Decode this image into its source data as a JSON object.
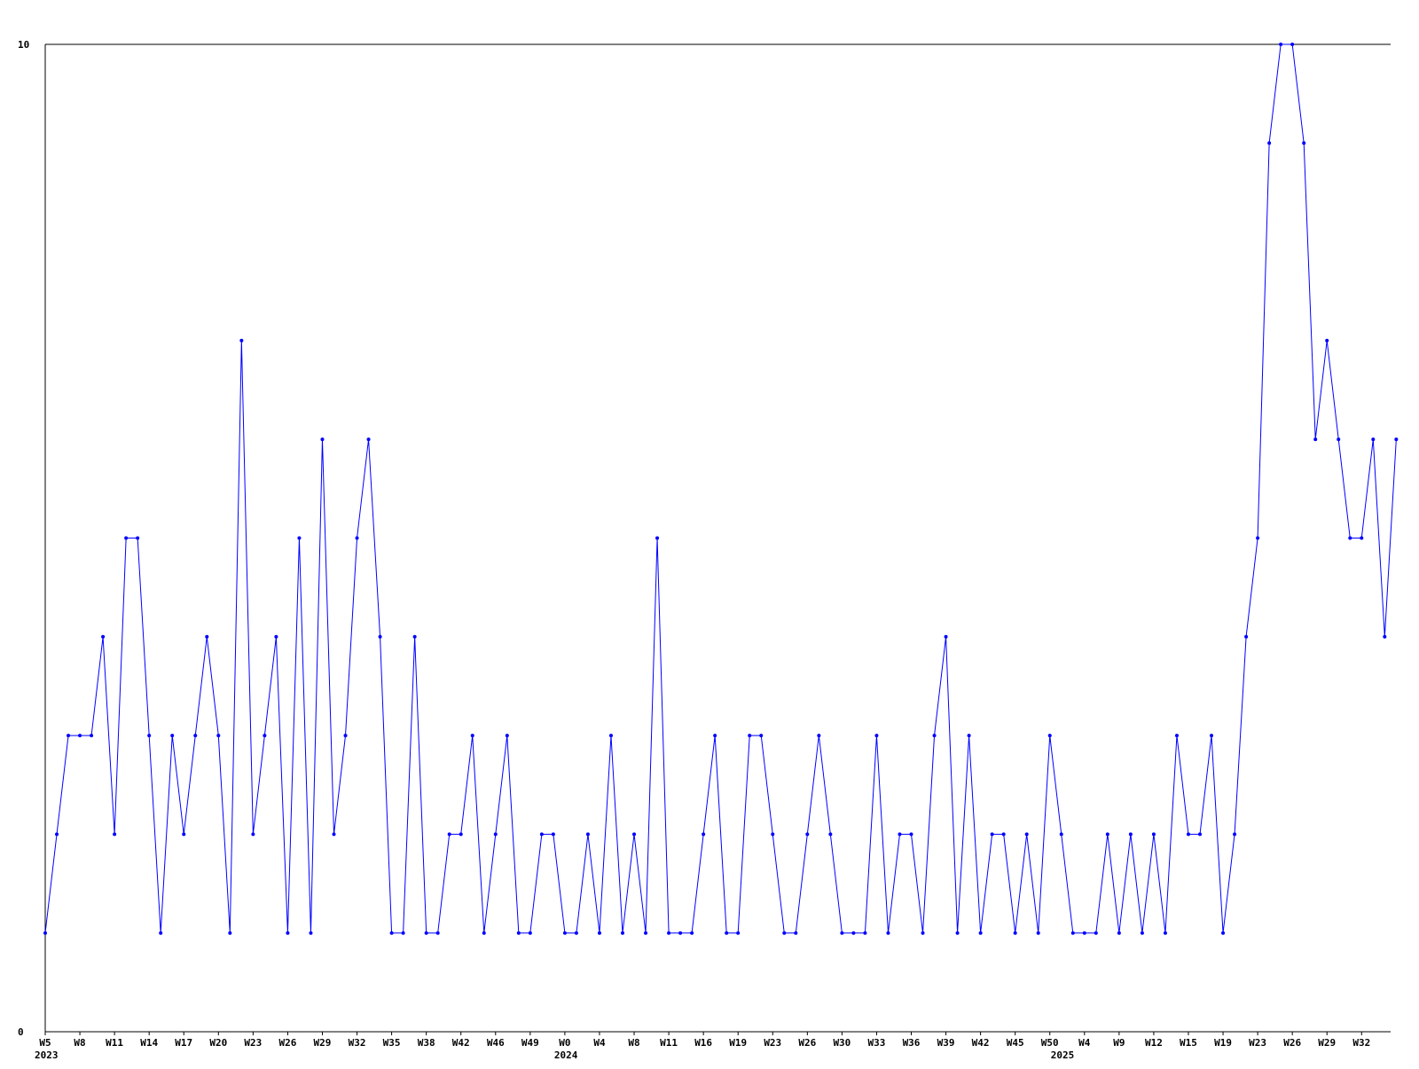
{
  "chart_data": {
    "type": "line",
    "title": "",
    "xlabel": "",
    "ylabel": "",
    "ylim": [
      0,
      10
    ],
    "y_ticks": [
      "0",
      "10"
    ],
    "grid": false,
    "legend": "none",
    "line_color": "#0000ff",
    "axis_color": "#000000",
    "x_tick_labels": [
      {
        "i": 0,
        "label": "W5"
      },
      {
        "i": 3,
        "label": "W8"
      },
      {
        "i": 6,
        "label": "W11"
      },
      {
        "i": 9,
        "label": "W14"
      },
      {
        "i": 12,
        "label": "W17"
      },
      {
        "i": 15,
        "label": "W20"
      },
      {
        "i": 18,
        "label": "W23"
      },
      {
        "i": 21,
        "label": "W26"
      },
      {
        "i": 24,
        "label": "W29"
      },
      {
        "i": 27,
        "label": "W32"
      },
      {
        "i": 30,
        "label": "W35"
      },
      {
        "i": 33,
        "label": "W38"
      },
      {
        "i": 36,
        "label": "W42"
      },
      {
        "i": 39,
        "label": "W46"
      },
      {
        "i": 42,
        "label": "W49"
      },
      {
        "i": 45,
        "label": "W0"
      },
      {
        "i": 48,
        "label": "W4"
      },
      {
        "i": 51,
        "label": "W8"
      },
      {
        "i": 54,
        "label": "W11"
      },
      {
        "i": 57,
        "label": "W16"
      },
      {
        "i": 60,
        "label": "W19"
      },
      {
        "i": 63,
        "label": "W23"
      },
      {
        "i": 66,
        "label": "W26"
      },
      {
        "i": 69,
        "label": "W30"
      },
      {
        "i": 72,
        "label": "W33"
      },
      {
        "i": 75,
        "label": "W36"
      },
      {
        "i": 78,
        "label": "W39"
      },
      {
        "i": 81,
        "label": "W42"
      },
      {
        "i": 84,
        "label": "W45"
      },
      {
        "i": 87,
        "label": "W50"
      },
      {
        "i": 90,
        "label": "W4"
      },
      {
        "i": 93,
        "label": "W9"
      },
      {
        "i": 96,
        "label": "W12"
      },
      {
        "i": 99,
        "label": "W15"
      },
      {
        "i": 102,
        "label": "W19"
      },
      {
        "i": 105,
        "label": "W23"
      },
      {
        "i": 108,
        "label": "W26"
      },
      {
        "i": 111,
        "label": "W29"
      },
      {
        "i": 114,
        "label": "W32"
      }
    ],
    "year_labels": [
      {
        "i": 0,
        "label": "2023"
      },
      {
        "i": 45,
        "label": "2024"
      },
      {
        "i": 88,
        "label": "2025"
      }
    ],
    "values": [
      1,
      2,
      3,
      3,
      3,
      4,
      2,
      5,
      5,
      3,
      1,
      3,
      2,
      3,
      4,
      3,
      1,
      7,
      2,
      3,
      4,
      1,
      5,
      1,
      6,
      2,
      3,
      5,
      6,
      4,
      1,
      1,
      4,
      1,
      1,
      2,
      2,
      3,
      1,
      2,
      3,
      1,
      1,
      2,
      2,
      1,
      1,
      2,
      1,
      3,
      1,
      2,
      1,
      5,
      1,
      1,
      1,
      2,
      3,
      1,
      1,
      3,
      3,
      2,
      1,
      1,
      2,
      3,
      2,
      1,
      1,
      1,
      3,
      1,
      2,
      2,
      1,
      3,
      4,
      1,
      3,
      1,
      2,
      2,
      1,
      2,
      1,
      3,
      2,
      1,
      1,
      1,
      2,
      1,
      2,
      1,
      2,
      1,
      3,
      2,
      2,
      3,
      1,
      2,
      4,
      5,
      9,
      10,
      10,
      9,
      6,
      7,
      6,
      5,
      5,
      6,
      4,
      6
    ]
  }
}
